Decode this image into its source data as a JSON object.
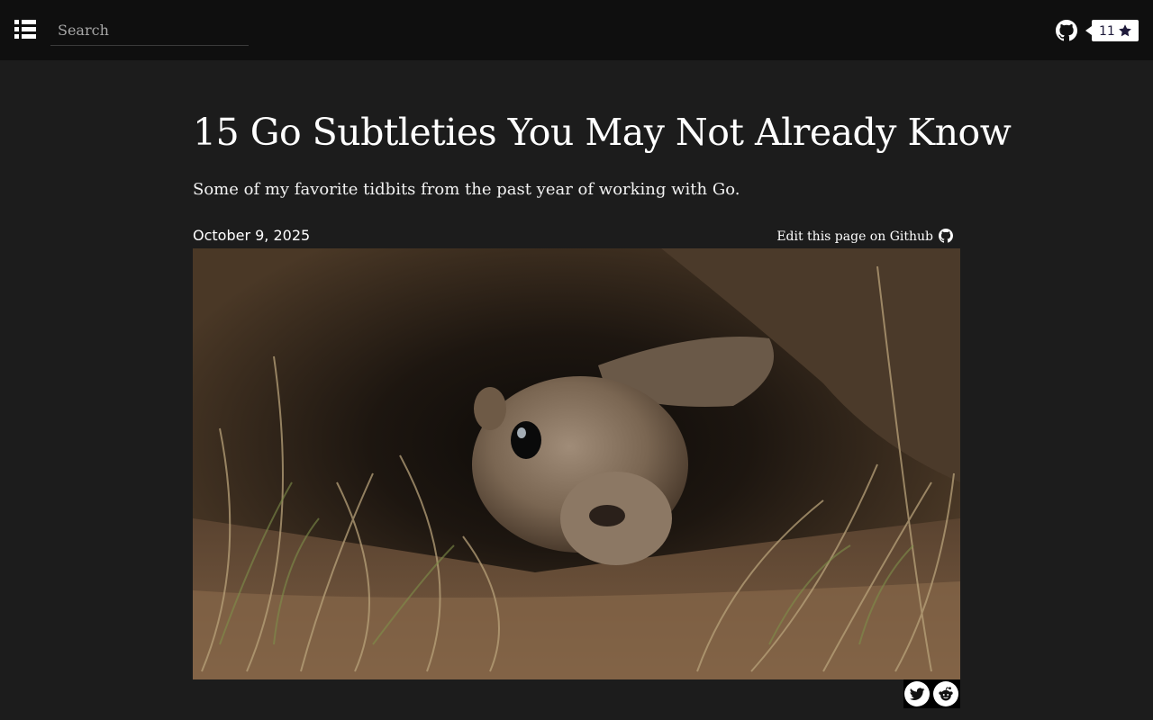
{
  "header": {
    "menu_icon": "list-icon",
    "search_placeholder": "Search",
    "github_icon": "github-icon",
    "star_count": "11",
    "star_icon": "star-icon"
  },
  "article": {
    "title": "15 Go Subtleties You May Not Already Know",
    "subtitle": "Some of my favorite tidbits from the past year of working with Go.",
    "date": "October 9, 2025",
    "edit_link": "Edit this page on Github",
    "hero_image": "ground-squirrel-peeking-from-burrow-photo"
  },
  "share": {
    "twitter_icon": "twitter-icon",
    "reddit_icon": "reddit-icon"
  },
  "colors": {
    "page_background": "#1c1c1c",
    "topbar_background": "#0f0f0f",
    "text": "#ffffff",
    "badge_text": "#1e1a3a"
  }
}
